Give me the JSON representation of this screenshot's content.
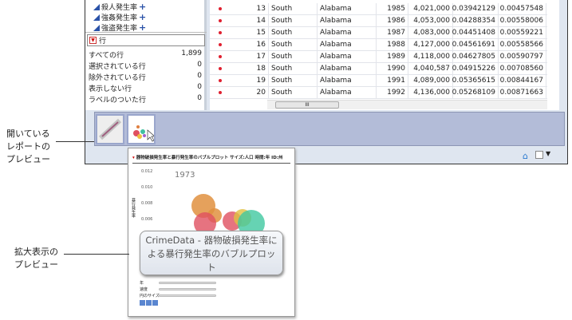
{
  "columns_panel": {
    "items": [
      {
        "label": "殺人発生率"
      },
      {
        "label": "強姦発生率"
      },
      {
        "label": "強盗発生率"
      }
    ]
  },
  "rows_panel": {
    "title": "行",
    "stats": [
      {
        "label": "すべての行",
        "value": "1,899"
      },
      {
        "label": "選択されている行",
        "value": "0"
      },
      {
        "label": "除外されている行",
        "value": "0"
      },
      {
        "label": "表示しない行",
        "value": "0"
      },
      {
        "label": "ラベルのついた行",
        "value": "0"
      }
    ]
  },
  "table": {
    "rows": [
      [
        "13",
        "South",
        "Alabama",
        "1985",
        "4,021,000",
        "0.03942129",
        "0.00457548"
      ],
      [
        "14",
        "South",
        "Alabama",
        "1986",
        "4,053,000",
        "0.04288354",
        "0.00558006"
      ],
      [
        "15",
        "South",
        "Alabama",
        "1987",
        "4,083,000",
        "0.04451408",
        "0.00559221"
      ],
      [
        "16",
        "South",
        "Alabama",
        "1988",
        "4,127,000",
        "0.04561691",
        "0.00558566"
      ],
      [
        "17",
        "South",
        "Alabama",
        "1989",
        "4,118,000",
        "0.04627805",
        "0.00590797"
      ],
      [
        "18",
        "South",
        "Alabama",
        "1990",
        "4,040,587",
        "0.04915226",
        "0.00708560"
      ],
      [
        "19",
        "South",
        "Alabama",
        "1991",
        "4,089,000",
        "0.05365615",
        "0.00844167"
      ],
      [
        "20",
        "South",
        "Alabama",
        "1992",
        "4,136,000",
        "0.05268109",
        "0.00871663"
      ]
    ],
    "scroll_grip": "III"
  },
  "preview": {
    "title": "器物破損発生率と暴行発生率のバブルプロット サイズ:人口 時間:年 ID:州",
    "year": "1973",
    "y_ticks": [
      "0.012",
      "0.010",
      "0.008",
      "0.006"
    ],
    "y_label": "暴行発生率",
    "tooltip": "CrimeData - 器物破損発生率による暴行発生率のバブルプロット",
    "sliders": [
      {
        "label": "年"
      },
      {
        "label": "速度"
      },
      {
        "label": "円のサイズ"
      }
    ]
  },
  "callouts": {
    "open_reports": "開いている\nレポートの\nプレビュー",
    "enlarged": "拡大表示の\nプレビュー"
  }
}
